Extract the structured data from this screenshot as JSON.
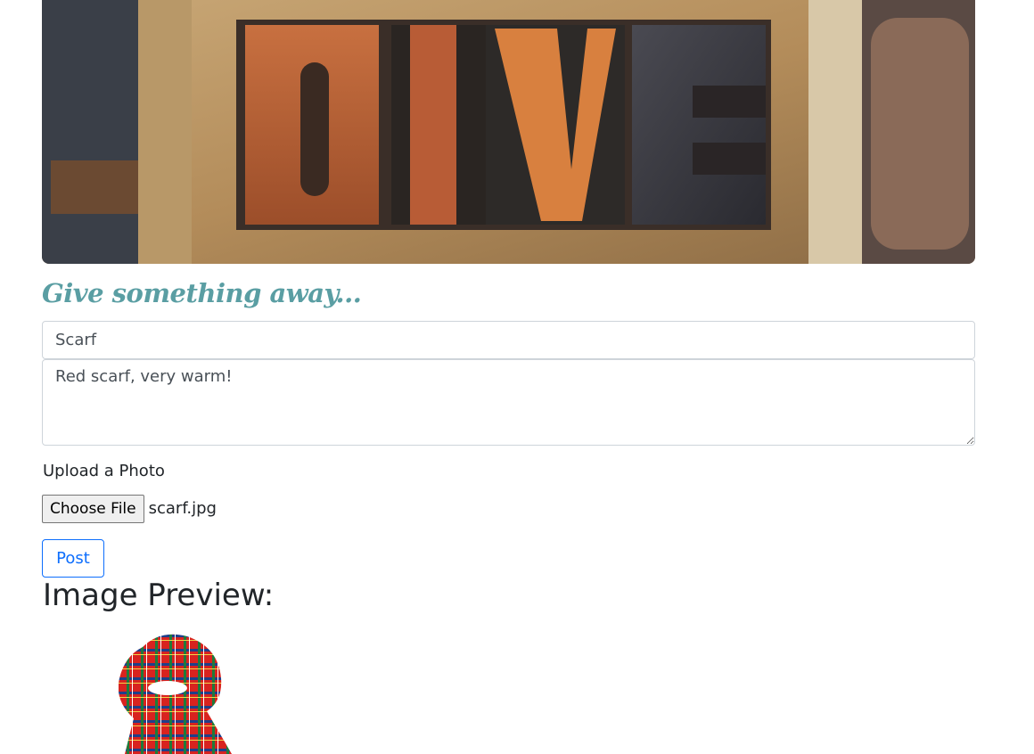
{
  "banner": {
    "word": "GIVE",
    "letters": [
      "G",
      "I",
      "V",
      "E"
    ]
  },
  "form": {
    "heading": "Give something away...",
    "title_value": "Scarf",
    "description_value": "Red scarf, very warm!",
    "upload_label": "Upload a Photo",
    "choose_file_label": "Choose File",
    "file_name": "scarf.jpg",
    "post_label": "Post"
  },
  "preview": {
    "heading": "Image Preview:"
  },
  "colors": {
    "heading_teal": "#5a9ea3",
    "primary_blue": "#0d6efd",
    "border_gray": "#ced4da"
  }
}
